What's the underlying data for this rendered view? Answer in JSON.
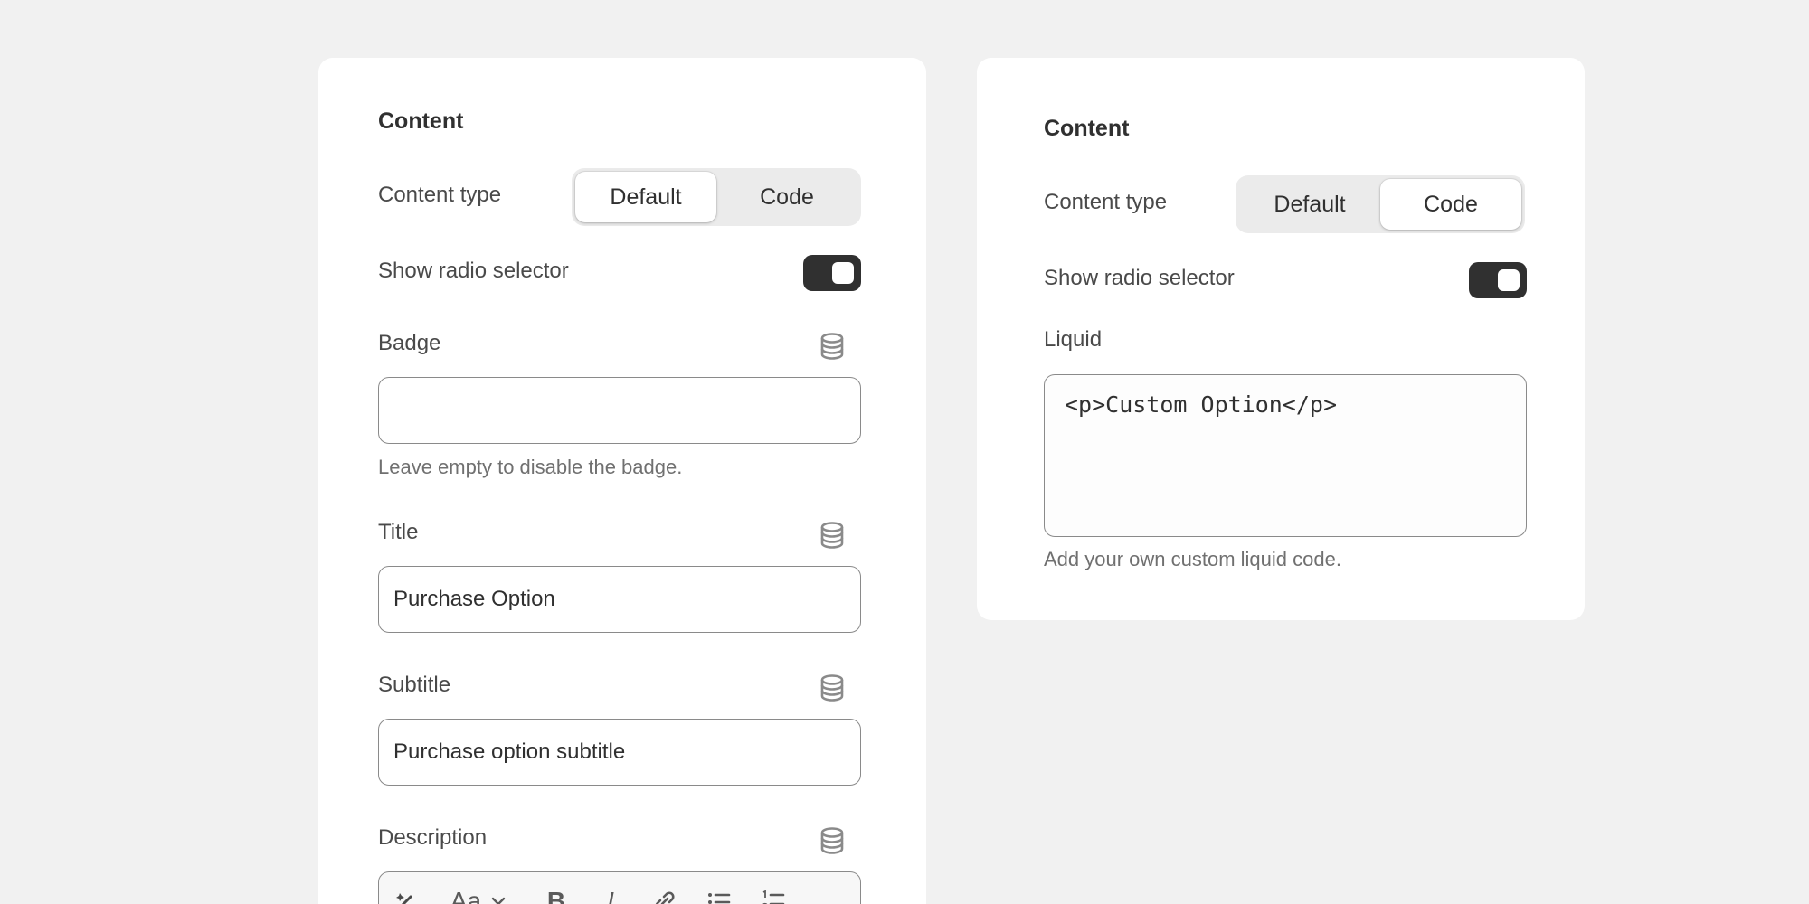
{
  "left_panel": {
    "heading": "Content",
    "content_type": {
      "label": "Content type",
      "options": [
        "Default",
        "Code"
      ],
      "selected": "Default"
    },
    "show_radio_selector": {
      "label": "Show radio selector",
      "on": true
    },
    "badge": {
      "label": "Badge",
      "value": "",
      "help": "Leave empty to disable the badge."
    },
    "title": {
      "label": "Title",
      "value": "Purchase Option"
    },
    "subtitle": {
      "label": "Subtitle",
      "value": "Purchase option subtitle"
    },
    "description": {
      "label": "Description"
    },
    "toolbar_icons": [
      "magic-icon",
      "font-size-icon",
      "chevron-down-icon",
      "bold-icon",
      "italic-icon",
      "link-icon",
      "bullet-list-icon",
      "numbered-list-icon"
    ],
    "toolbar_text": {
      "font": "Aa",
      "bold": "B",
      "italic": "I"
    }
  },
  "right_panel": {
    "heading": "Content",
    "content_type": {
      "label": "Content type",
      "options": [
        "Default",
        "Code"
      ],
      "selected": "Code"
    },
    "show_radio_selector": {
      "label": "Show radio selector",
      "on": true
    },
    "liquid": {
      "label": "Liquid",
      "value": "<p>Custom Option</p>",
      "help": "Add your own custom liquid code."
    }
  },
  "colors": {
    "page_bg": "#f1f1f1",
    "panel_bg": "#ffffff",
    "toggle_on": "#303030",
    "border": "#8a8a8a"
  }
}
